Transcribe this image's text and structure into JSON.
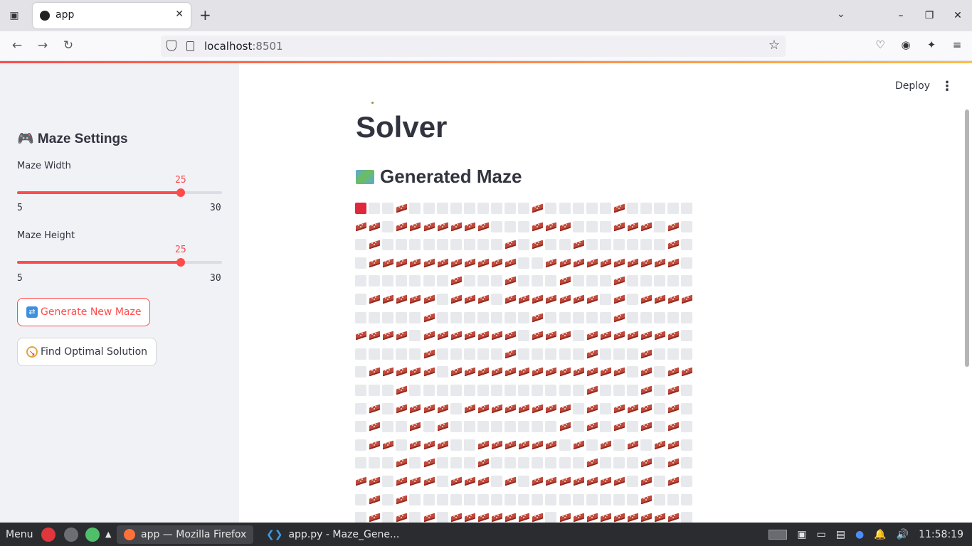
{
  "browser": {
    "tab_title": "app",
    "url_host": "localhost",
    "url_port": ":8501"
  },
  "sidebar": {
    "header": "🎮 Maze Settings",
    "width_slider": {
      "label": "Maze Width",
      "value": "25",
      "min": "5",
      "max": "30",
      "fraction": 0.8
    },
    "height_slider": {
      "label": "Maze Height",
      "value": "25",
      "min": "5",
      "max": "30",
      "fraction": 0.8
    },
    "generate_button": {
      "label": "Generate New Maze",
      "icon": "shuffle-icon"
    },
    "solve_button": {
      "label": "Find Optimal Solution",
      "icon": "compass-icon"
    }
  },
  "main": {
    "deploy_label": "Deploy",
    "title": "Solver",
    "subheader": "Generated Maze",
    "maze_rows": [
      "SOOWOOOOOOOOOWOOOOOWOOOOO",
      "WWOWWWWWWWOOOWWWOOOWWWOWO",
      "OWOOOOOOOOOWOWOOWOOOOOOWO",
      "OWWWWWWWWWWWOOWWWWWWWWWWO",
      "OOOOOOOWOOOWOOOWOOOWOOOOO",
      "OWWWWWOWWWOWWWWWWWOWOWWWW",
      "OOOOOWOOOOOOOWOOOOOWOOOOO",
      "WWWWOWWWWWWWOWWWOWWWWWWWO",
      "OOOOOWOOOOOWOOOOOWOOOWOOO",
      "OWWWWWOWWWWWWWWWWWWWOWOWW",
      "OOOWOOOOOOOOOOOOOWOOOWOWO",
      "OWOWWWWOWWWWWWWWOWOWWWOWO",
      "OWOOWOWOOOOOOOOWOWOWOWOWO",
      "OWWOWWWOOWWWWWWOWOWOWOWWO",
      "OOOWOWOOOWOOOOOOOWOOOWOWO",
      "WWOWWWOWWWOWOWWWWWWWOWOWO",
      "OWOWOOOOOOOOOOOOOOOOOWOOO",
      "OWOWOWOWWWWWWWOWWWWWWWWWO"
    ]
  },
  "taskbar": {
    "menu_label": "Menu",
    "firefox_window": "app — Mozilla Firefox",
    "vscode_window": "app.py - Maze_Gene...",
    "clock": "11:58:19"
  }
}
